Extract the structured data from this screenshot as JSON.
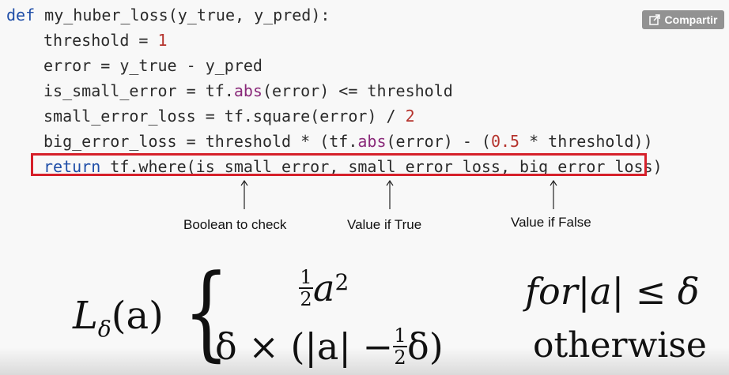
{
  "share_button": {
    "label": "Compartir",
    "icon": "share-icon"
  },
  "code": {
    "def_kw": "def",
    "fn_sig": " my_huber_loss(y_true, y_pred):",
    "l2_a": "threshold = ",
    "l2_num": "1",
    "l3": "error = y_true - y_pred",
    "l4_a": "is_small_error = tf.",
    "l4_fn": "abs",
    "l4_b": "(error) <= threshold",
    "l5_a": "small_error_loss = tf.square(error) / ",
    "l5_num": "2",
    "l6_a": "big_error_loss = threshold * (tf.",
    "l6_fn": "abs",
    "l6_b": "(error) - (",
    "l6_num": "0.5",
    "l6_c": " * threshold))",
    "l7_kw": "return",
    "l7_b": " tf.where(is_small_error, small_error_loss, big_error_loss)"
  },
  "annotations": {
    "boolean": "Boolean to check",
    "true_val": "Value if True",
    "false_val": "Value if False"
  },
  "formula": {
    "L": "L",
    "delta_sub": "δ",
    "arg": "(a)",
    "brace": "{",
    "half_num": "1",
    "half_den": "2",
    "a_var": "a",
    "a_exp": "2",
    "case1_cond": "for|a| ≤ δ",
    "case2_expr_pre": "δ × (|a| − ",
    "case2_expr_post": "δ)",
    "case2_cond": "otherwise"
  },
  "colors": {
    "keyword": "#1f4ea8",
    "number": "#b5332d",
    "builtin": "#8a2a7a",
    "highlight_border": "#d6202a"
  }
}
